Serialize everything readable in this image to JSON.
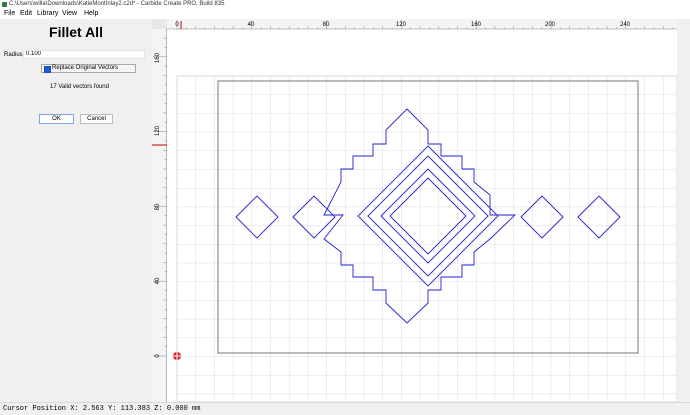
{
  "window": {
    "title": "C:\\Users\\willa\\Downloads\\KatieMontInlay2.c2d* - Carbide Create PRO, Build 835"
  },
  "menu": [
    {
      "label": "File",
      "underline": "F"
    },
    {
      "label": "Edit",
      "underline": "E"
    },
    {
      "label": "Library",
      "underline": ""
    },
    {
      "label": "View",
      "underline": ""
    },
    {
      "label": "Help",
      "underline": "H"
    }
  ],
  "panel": {
    "title": "Fillet All",
    "radius_label": "Radius",
    "radius_value": "0.100",
    "replace_label": "Replace Original Vectors",
    "replace_checked": true,
    "valid_text": "17 Valid vectors found",
    "ok_label": "OK",
    "cancel_label": "Cancel"
  },
  "ruler": {
    "top_ticks": [
      "0",
      "40",
      "80",
      "120",
      "160",
      "200",
      "240"
    ],
    "left_ticks": [
      "160",
      "120",
      "80",
      "40",
      "0"
    ]
  },
  "colors": {
    "vector": "#2222cc",
    "grid": "#dcdcdc",
    "stock_border": "#555555",
    "ruler_marker": "#cc0000"
  },
  "status": {
    "text": "Cursor Position X: 2.563 Y: 113.383 Z: 0.000 mm"
  }
}
